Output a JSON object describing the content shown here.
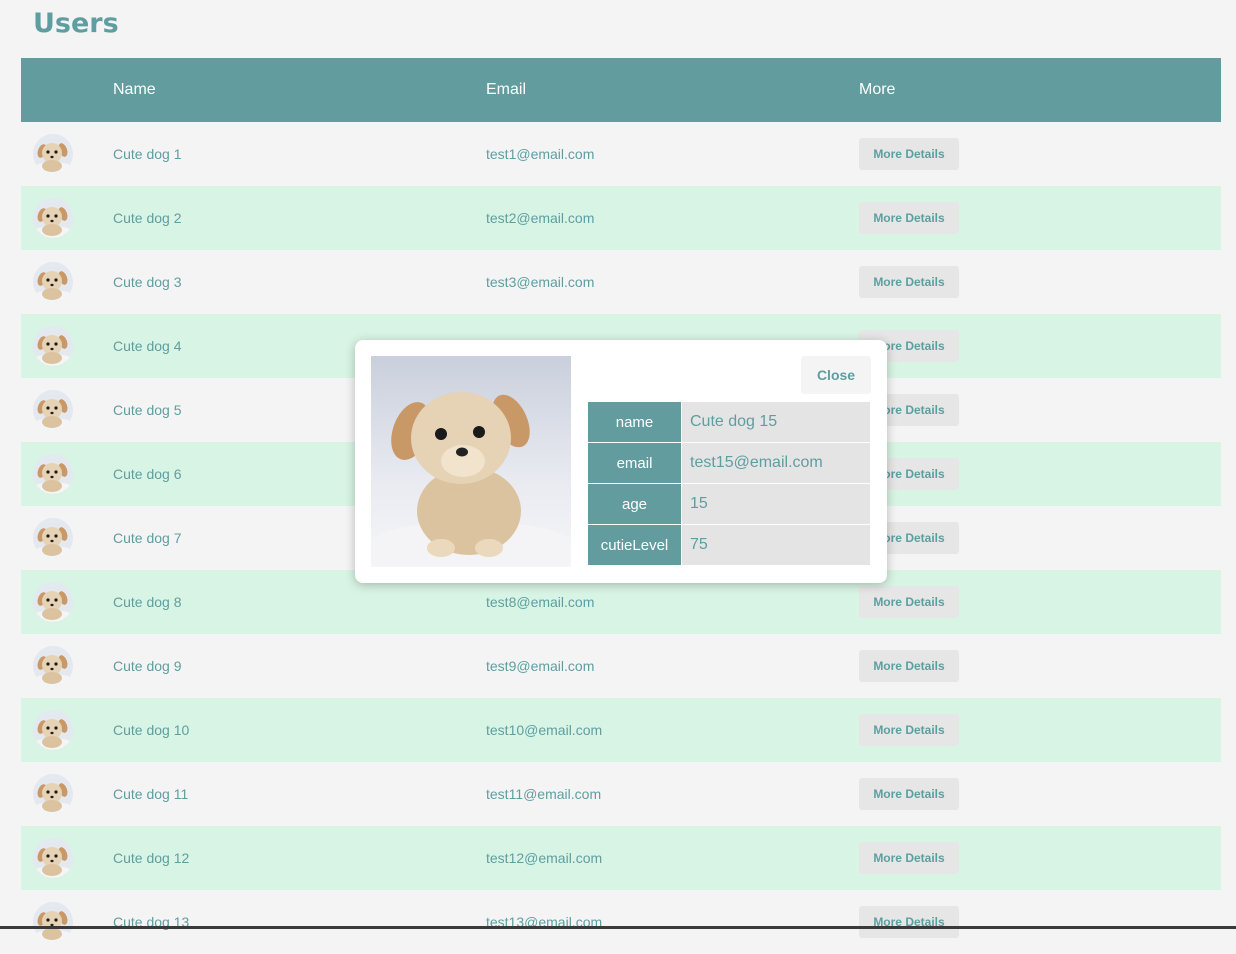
{
  "page": {
    "title": "Users"
  },
  "table": {
    "headers": {
      "name": "Name",
      "email": "Email",
      "more": "More"
    },
    "button_label": "More Details",
    "rows": [
      {
        "name": "Cute dog 1",
        "email": "test1@email.com"
      },
      {
        "name": "Cute dog 2",
        "email": "test2@email.com"
      },
      {
        "name": "Cute dog 3",
        "email": "test3@email.com"
      },
      {
        "name": "Cute dog 4",
        "email": ""
      },
      {
        "name": "Cute dog 5",
        "email": ""
      },
      {
        "name": "Cute dog 6",
        "email": ""
      },
      {
        "name": "Cute dog 7",
        "email": ""
      },
      {
        "name": "Cute dog 8",
        "email": "test8@email.com"
      },
      {
        "name": "Cute dog 9",
        "email": "test9@email.com"
      },
      {
        "name": "Cute dog 10",
        "email": "test10@email.com"
      },
      {
        "name": "Cute dog 11",
        "email": "test11@email.com"
      },
      {
        "name": "Cute dog 12",
        "email": "test12@email.com"
      },
      {
        "name": "Cute dog 13",
        "email": "test13@email.com"
      }
    ]
  },
  "modal": {
    "close_label": "Close",
    "fields": [
      {
        "key": "name",
        "value": "Cute dog 15"
      },
      {
        "key": "email",
        "value": "test15@email.com"
      },
      {
        "key": "age",
        "value": "15"
      },
      {
        "key": "cutieLevel",
        "value": "75"
      }
    ]
  },
  "colors": {
    "accent": "#5f9ea0",
    "header_bg": "#629c9e",
    "row_alt_bg": "#d8f4e4",
    "page_bg": "#f4f4f4"
  }
}
